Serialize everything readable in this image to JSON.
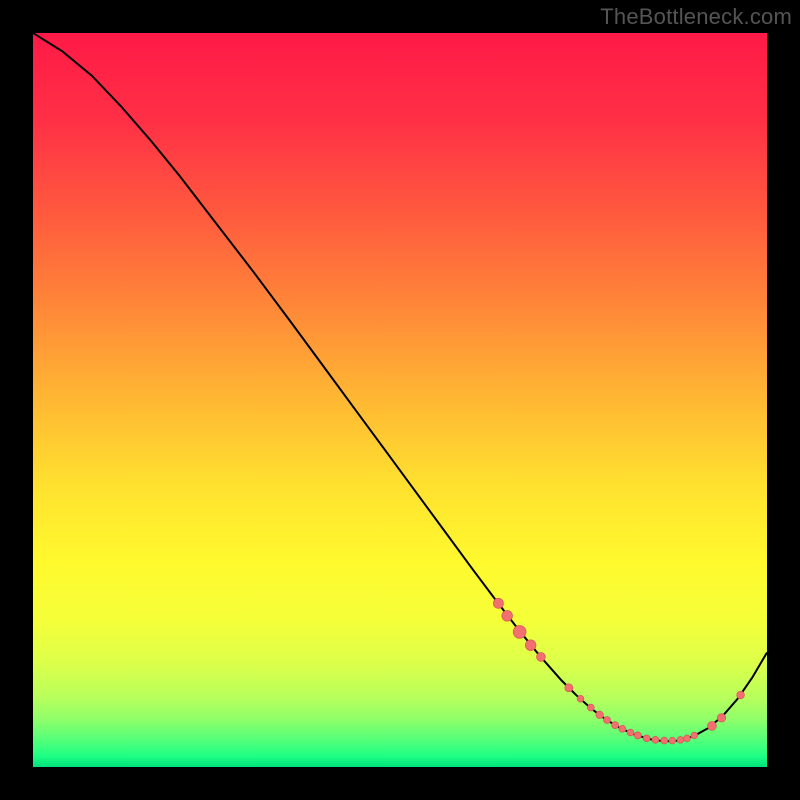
{
  "attribution": "TheBottleneck.com",
  "colors": {
    "marker_fill": "#f2706f",
    "marker_stroke": "#db5a58",
    "curve": "#000000",
    "gradient_stops": [
      {
        "offset": 0.0,
        "color": "#ff1a47"
      },
      {
        "offset": 0.12,
        "color": "#ff3046"
      },
      {
        "offset": 0.25,
        "color": "#ff5b3e"
      },
      {
        "offset": 0.38,
        "color": "#ff8a38"
      },
      {
        "offset": 0.5,
        "color": "#ffb833"
      },
      {
        "offset": 0.62,
        "color": "#ffe22f"
      },
      {
        "offset": 0.72,
        "color": "#fff92e"
      },
      {
        "offset": 0.8,
        "color": "#f5ff39"
      },
      {
        "offset": 0.86,
        "color": "#dbff4a"
      },
      {
        "offset": 0.905,
        "color": "#b8ff5c"
      },
      {
        "offset": 0.935,
        "color": "#8fff6a"
      },
      {
        "offset": 0.96,
        "color": "#5bff78"
      },
      {
        "offset": 0.985,
        "color": "#1eff84"
      },
      {
        "offset": 1.0,
        "color": "#00e07b"
      }
    ]
  },
  "chart_data": {
    "type": "line",
    "title": "",
    "xlabel": "",
    "ylabel": "",
    "xlim": [
      0,
      100
    ],
    "ylim": [
      0,
      100
    ],
    "grid": false,
    "series": [
      {
        "name": "bottleneck-curve",
        "x": [
          0,
          4,
          8,
          12,
          16,
          20,
          25,
          30,
          35,
          40,
          45,
          50,
          55,
          60,
          63,
          66,
          69,
          72,
          74,
          76,
          78,
          80,
          82,
          84,
          86,
          88,
          90,
          92,
          94,
          96,
          98,
          100
        ],
        "y": [
          100,
          97.5,
          94.2,
          90.0,
          85.4,
          80.5,
          74.0,
          67.5,
          60.8,
          54.0,
          47.2,
          40.4,
          33.6,
          26.8,
          22.8,
          18.9,
          15.2,
          11.8,
          9.8,
          8.0,
          6.5,
          5.3,
          4.4,
          3.8,
          3.5,
          3.6,
          4.2,
          5.3,
          7.0,
          9.3,
          12.2,
          15.6
        ]
      }
    ],
    "markers": {
      "name": "marker-cluster",
      "points": [
        {
          "x": 63.4,
          "y": 22.3,
          "r": 5.0
        },
        {
          "x": 64.6,
          "y": 20.6,
          "r": 5.3
        },
        {
          "x": 66.3,
          "y": 18.4,
          "r": 6.4
        },
        {
          "x": 67.8,
          "y": 16.6,
          "r": 5.3
        },
        {
          "x": 69.2,
          "y": 15.0,
          "r": 4.4
        },
        {
          "x": 73.0,
          "y": 10.8,
          "r": 4.0
        },
        {
          "x": 74.6,
          "y": 9.3,
          "r": 3.3
        },
        {
          "x": 76.0,
          "y": 8.1,
          "r": 3.4
        },
        {
          "x": 77.2,
          "y": 7.1,
          "r": 3.7
        },
        {
          "x": 78.2,
          "y": 6.4,
          "r": 3.5
        },
        {
          "x": 79.3,
          "y": 5.7,
          "r": 3.5
        },
        {
          "x": 80.3,
          "y": 5.2,
          "r": 3.4
        },
        {
          "x": 81.4,
          "y": 4.7,
          "r": 3.4
        },
        {
          "x": 82.4,
          "y": 4.3,
          "r": 3.5
        },
        {
          "x": 83.6,
          "y": 3.9,
          "r": 3.4
        },
        {
          "x": 84.8,
          "y": 3.7,
          "r": 3.4
        },
        {
          "x": 86.0,
          "y": 3.6,
          "r": 3.4
        },
        {
          "x": 87.1,
          "y": 3.6,
          "r": 3.3
        },
        {
          "x": 88.2,
          "y": 3.7,
          "r": 3.3
        },
        {
          "x": 89.1,
          "y": 3.9,
          "r": 3.3
        },
        {
          "x": 90.1,
          "y": 4.3,
          "r": 3.3
        },
        {
          "x": 92.5,
          "y": 5.6,
          "r": 4.4
        },
        {
          "x": 93.8,
          "y": 6.7,
          "r": 4.2
        },
        {
          "x": 96.4,
          "y": 9.8,
          "r": 3.8
        }
      ]
    }
  }
}
